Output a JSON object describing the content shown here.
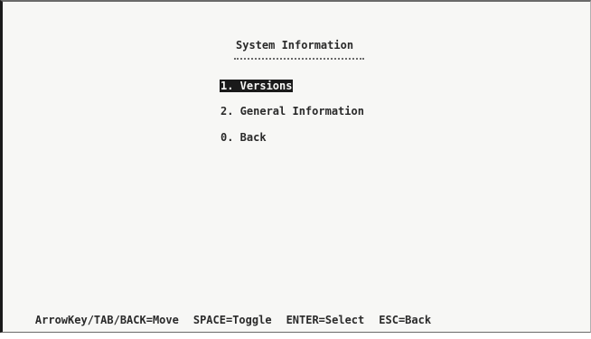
{
  "screen": {
    "title": "System Information"
  },
  "menu": {
    "items": [
      {
        "label": "1. Versions"
      },
      {
        "label": "2. General Information"
      },
      {
        "label": "0. Back"
      }
    ]
  },
  "help": {
    "move": "ArrowKey/TAB/BACK=Move",
    "toggle": "SPACE=Toggle",
    "select": "ENTER=Select",
    "back": "ESC=Back"
  }
}
